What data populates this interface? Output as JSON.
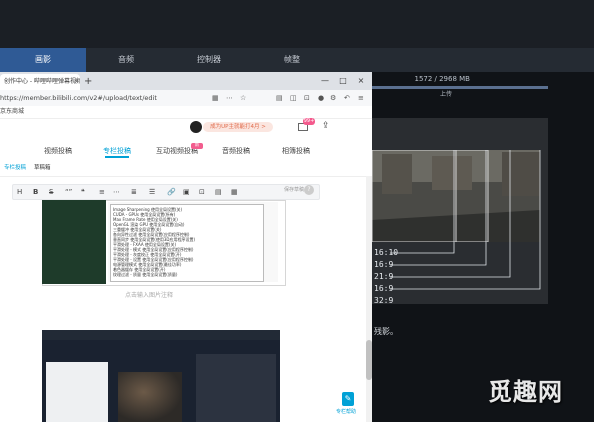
{
  "background_app": {
    "tabs": [
      "画影",
      "音频",
      "控制器",
      "帧整"
    ],
    "file_size": "1572 / 2968 MB",
    "upload_label": "上传",
    "timestamps": [
      "16:10",
      "16:9",
      "21:9",
      "16:9",
      "32:9"
    ],
    "caption_fragment": "残影。",
    "watermark": "觅趣网"
  },
  "browser": {
    "tab_title": "创作中心 - 哔哩哔哩弹幕视频网",
    "tab_close": "×",
    "new_tab": "+",
    "window_controls": [
      "—",
      "□",
      "×"
    ],
    "url": "https://member.bilibili.com/v2#/upload/text/edit",
    "bookmark": "京东商城"
  },
  "page": {
    "vip_text": "成为UP主就能打4月 >",
    "msg_badge": "99+",
    "nav_tabs": [
      "视频投稿",
      "专栏投稿",
      "互动视频投稿",
      "音频投稿",
      "相簿投稿"
    ],
    "hot_badge": "新",
    "sub_tabs": [
      "专栏投稿",
      "草稿箱"
    ],
    "toolbar_buttons": [
      "H",
      "B",
      "S",
      "“”",
      "❝",
      "≡",
      "⋯",
      "≣",
      "☰",
      "🔗",
      "▣",
      "⊡",
      "▤",
      "▦"
    ],
    "autosave": "保存草稿",
    "help": "?",
    "caption_hint": "点击输入图片注释",
    "side_help": "专栏帮助"
  },
  "context_menu": [
    "Image Sharpening           使用全局设置(关)",
    "CUDA - GPUs                使用全局设置(所有)",
    "Max Frame Rate             使用全局设置(关)",
    "OpenGL 渲染 GPU            使用全局设置(自动)",
    "三重缓冲                   使用全局设置(关)",
    "各向异性过滤               使用全局设置(应用程序控制)",
    "垂直同步                   使用全局设置(使用3D应用程序设置)",
    "平滑处理 - FXAA            使用全局设置(关)",
    "平滑处理 - 模式            使用全局设置(应用程序控制)",
    "平滑处理 - 灰度校正        使用全局设置(开)",
    "平滑处理 - 设置            使用全局设置(应用程序控制)",
    "电源管理模式               使用全局设置(最佳功率)",
    "着色器缓存                 使用全局设置(开)",
    "纹理过滤 - 质量            使用全局设置(质量)"
  ]
}
